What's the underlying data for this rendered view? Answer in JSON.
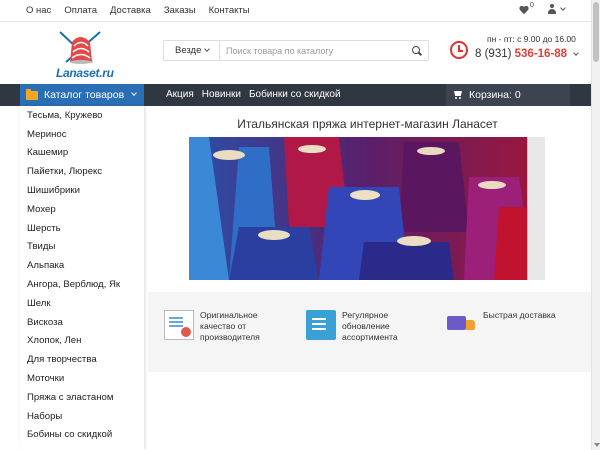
{
  "topnav": [
    "О нас",
    "Оплата",
    "Доставка",
    "Заказы",
    "Контакты"
  ],
  "wishlist_count": "0",
  "logo_text": "Lanaset.ru",
  "search": {
    "scope": "Везде",
    "placeholder": "Поиск товара по каталогу"
  },
  "contacts": {
    "hours": "пн - пт: с 9.00 до 16.00",
    "phone_prefix": "8 (931)",
    "phone_number": "536-16-88"
  },
  "catalog_label": "Каталог товаров",
  "mainnav": [
    "Акция",
    "Новинки",
    "Бобинки со скидкой"
  ],
  "cart_label": "Корзина: 0",
  "sidebar": [
    "Тесьма, Кружево",
    "Меринос",
    "Кашемир",
    "Пайетки, Люрекс",
    "Шишибрики",
    "Мохер",
    "Шерсть",
    "Твиды",
    "Альпака",
    "Ангора, Верблюд, Як",
    "Шелк",
    "Вискоза",
    "Хлопок, Лен",
    "Для творчества",
    "Моточки",
    "Пряжа с эластаном",
    "Наборы",
    "Бобины со скидкой"
  ],
  "main_title": "Итальянская пряжа интернет-магазин Ланасет",
  "features": [
    {
      "text_1": "Оригинальное",
      "text_2": "качество от",
      "text_3": "производителя"
    },
    {
      "text_1": "Регулярное",
      "text_2": "обновление",
      "text_3": "ассортимента"
    },
    {
      "text_1": "Быстрая доставка",
      "text_2": "",
      "text_3": ""
    }
  ],
  "colors": {
    "accent_blue": "#2a6fb5",
    "nav_dark": "#2f3741",
    "phone_red": "#e0403a"
  }
}
